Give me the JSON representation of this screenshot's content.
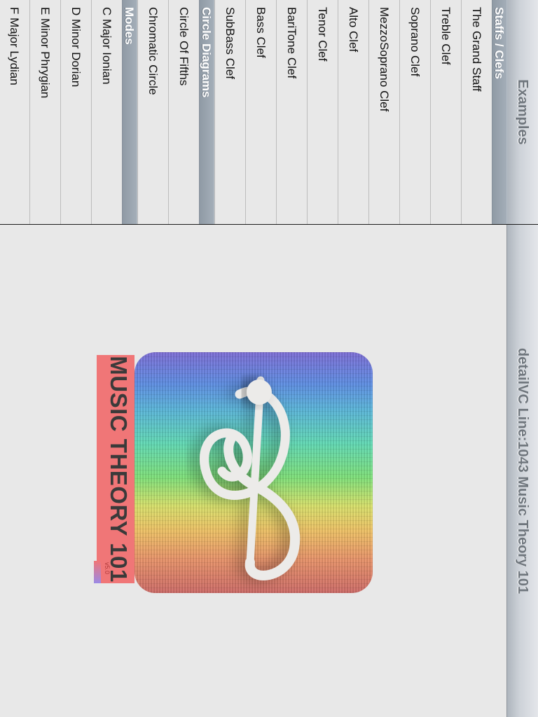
{
  "master": {
    "title": "Examples",
    "sections": [
      {
        "header": "Staffs / Clefs",
        "items": [
          "The Grand Staff",
          "Treble Clef",
          "Soprano Clef",
          "MezzoSoprano Clef",
          "Alto Clef",
          "Tenor Clef",
          "BariTone Clef",
          "Bass Clef",
          "SubBass Clef"
        ]
      },
      {
        "header": "Circle Diagrams",
        "items": [
          "Circle Of Fifths",
          "Chromatic Circle"
        ]
      },
      {
        "header": "Modes",
        "items": [
          "C Major Ionian",
          "D Minor Dorian",
          "E Minor Phrygian",
          "F Major Lydian"
        ]
      }
    ]
  },
  "detail": {
    "title": "detailVC Line:1043 Music Theory 101",
    "logo_text": "MUSIC THEORY 101",
    "version": "v5.0",
    "logo_icon": "treble-clef-icon"
  },
  "colors": {
    "banner": "#f07677",
    "section_header": "#95a0ab",
    "nav_title": "#6f767d"
  }
}
